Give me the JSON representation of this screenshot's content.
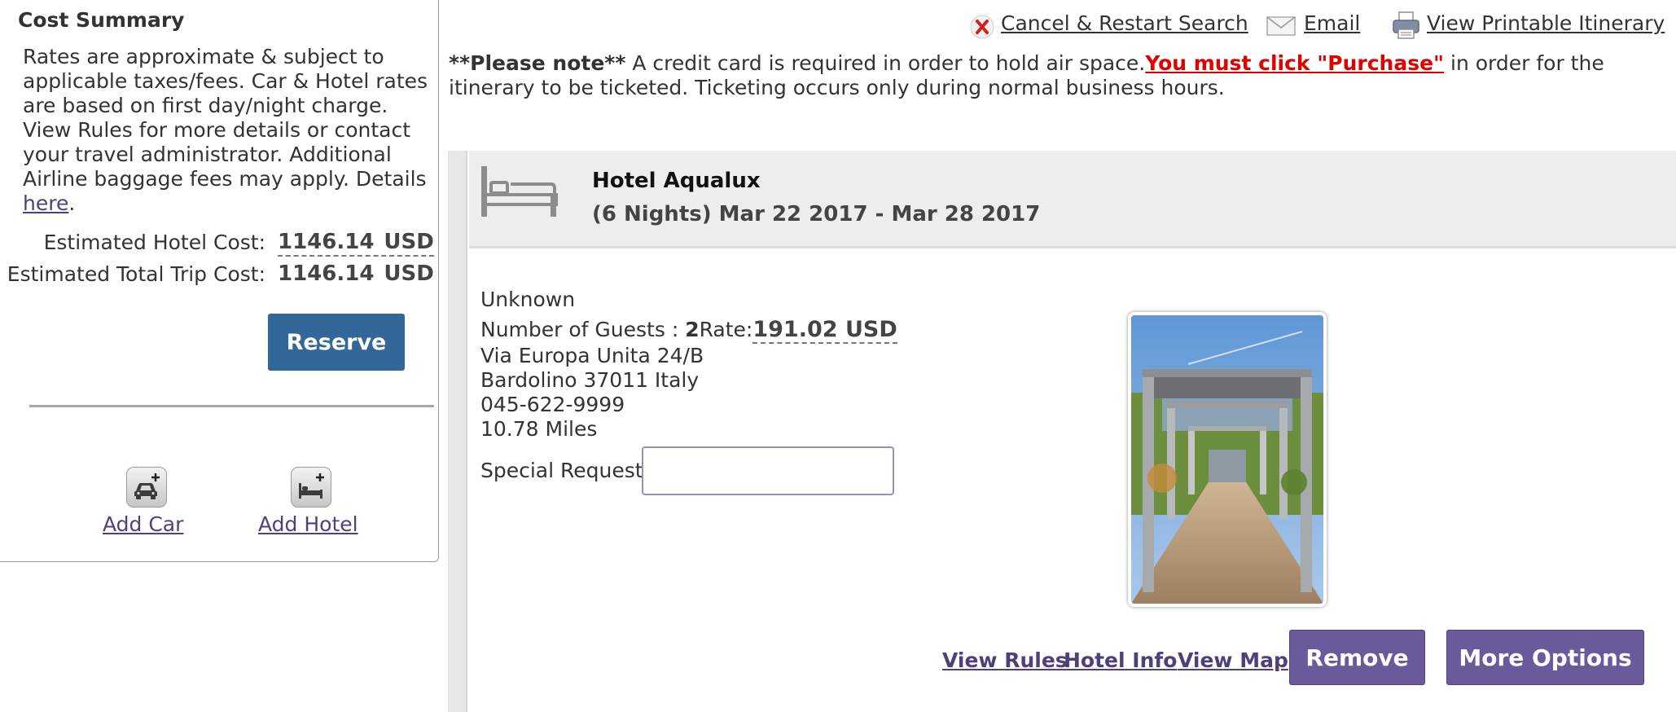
{
  "cost_summary": {
    "title": "Cost Summary",
    "note_text": "Rates are approximate & subject to applicable taxes/fees.  Car & Hotel rates are based on first day/night charge. View Rules for more details or contact your travel administrator. Additional Airline baggage fees may apply. Details ",
    "note_link": "here",
    "note_end": ".",
    "hotel_cost_label": "Estimated Hotel Cost:",
    "hotel_cost_value": "1146.14",
    "hotel_cost_currency": "USD",
    "total_cost_label": "Estimated Total Trip Cost:",
    "total_cost_value": "1146.14",
    "total_cost_currency": "USD",
    "reserve_label": "Reserve",
    "add_car_label": "Add Car",
    "add_hotel_label": "Add Hotel"
  },
  "top_links": {
    "cancel": "Cancel & Restart Search",
    "email": "Email",
    "print": "View Printable Itinerary"
  },
  "notice": {
    "prefix": "**Please note**",
    "text": " A credit card is required in order to hold air space.",
    "warning": "You must click \"Purchase\"",
    "suffix": " in order for the itinerary to be ticketed. Ticketing occurs only during normal business hours."
  },
  "hotel": {
    "name": "Hotel Aqualux",
    "dates": "(6 Nights) Mar 22 2017 - Mar 28 2017",
    "status": "Unknown",
    "guests_label": "Number of Guests : ",
    "guests_value": "2",
    "rate_label": "Rate:",
    "rate_value": "191.02",
    "rate_currency": "USD",
    "address_line1": "Via Europa Unita 24/B",
    "address_line2": "Bardolino 37011 Italy",
    "phone": "045-622-9999",
    "distance": "10.78 Miles",
    "special_request_label": "Special Request:",
    "special_request_value": ""
  },
  "actions": {
    "view_rules": "View Rules",
    "hotel_info": "Hotel Info",
    "view_map": "View Map",
    "remove": "Remove",
    "more_options": "More Options"
  },
  "colors": {
    "reserve_button": "#336699",
    "action_button": "#6a5a9c",
    "link": "#4f3f7a",
    "warning": "#e00000"
  },
  "icons": {
    "cancel": "red-x-icon",
    "email": "envelope-icon",
    "print": "printer-icon",
    "hotel": "bed-icon",
    "add_car": "add-car-icon",
    "add_hotel": "add-hotel-icon"
  }
}
